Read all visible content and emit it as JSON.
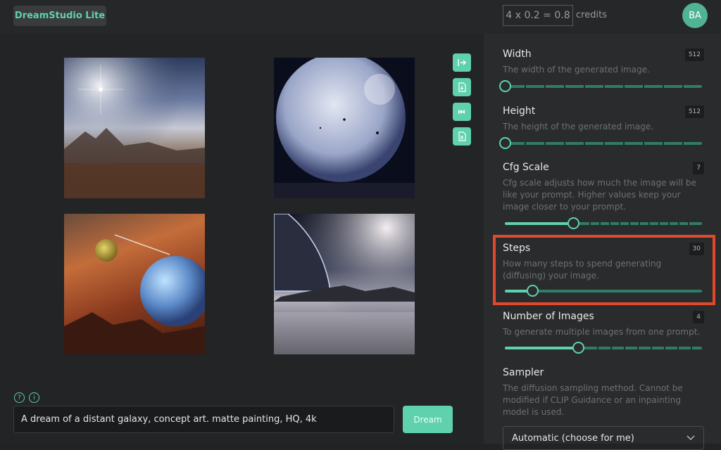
{
  "header": {
    "brand": "DreamStudio Lite",
    "credits_formula": "4 x 0.2 = 0.8",
    "credits_label": "credits",
    "avatar_initials": "BA"
  },
  "gallery": {
    "images": [
      {
        "alt": "Galaxy landscape with mountains"
      },
      {
        "alt": "Large planet in space"
      },
      {
        "alt": "Planets and comet over red landscape"
      },
      {
        "alt": "Planet over misty terrain"
      }
    ],
    "tools": [
      "export-icon",
      "download-icon",
      "rewind-icon",
      "file-icon"
    ]
  },
  "prompt": {
    "value": "A dream of a distant galaxy, concept art. matte painting, HQ, 4k",
    "button_label": "Dream"
  },
  "help": {
    "question": "?",
    "info": "i"
  },
  "settings": {
    "width": {
      "title": "Width",
      "value": "512",
      "desc": "The width of the generated image."
    },
    "height": {
      "title": "Height",
      "value": "512",
      "desc": "The height of the generated image."
    },
    "cfg": {
      "title": "Cfg Scale",
      "value": "7",
      "desc": "Cfg scale adjusts how much the image will be like your prompt. Higher values keep your image closer to your prompt."
    },
    "steps": {
      "title": "Steps",
      "value": "30",
      "desc": "How many steps to spend generating (diffusing) your image."
    },
    "num_images": {
      "title": "Number of Images",
      "value": "4",
      "desc": "To generate multiple images from one prompt."
    },
    "sampler": {
      "title": "Sampler",
      "desc": "The diffusion sampling method. Cannot be modified if CLIP Guidance or an inpainting model is used.",
      "selected": "Automatic (choose for me)"
    }
  },
  "colors": {
    "accent": "#5fd1ad",
    "highlight": "#e04a2b"
  }
}
